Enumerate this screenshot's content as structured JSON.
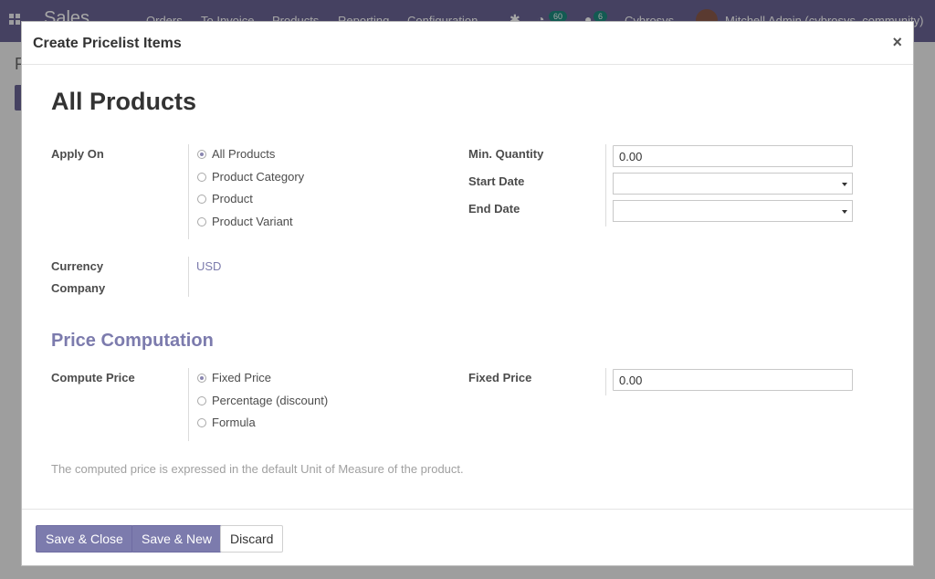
{
  "app": {
    "brand": "Sales",
    "menu": [
      "Orders",
      "To Invoice",
      "Products",
      "Reporting",
      "Configuration"
    ],
    "activity_count": "60",
    "messages_count": "6",
    "company": "Cybrosys",
    "user": "Mitchell Admin (cybrosys_community)",
    "page_title": "P"
  },
  "dialog": {
    "title": "Create Pricelist Items",
    "close_symbol": "×",
    "record_title": "All Products",
    "apply_on": {
      "label": "Apply On",
      "options": [
        "All Products",
        "Product Category",
        "Product",
        "Product Variant"
      ],
      "selected": "All Products"
    },
    "min_quantity": {
      "label": "Min. Quantity",
      "value": "0.00"
    },
    "start_date": {
      "label": "Start Date",
      "value": ""
    },
    "end_date": {
      "label": "End Date",
      "value": ""
    },
    "currency": {
      "label": "Currency",
      "value": "USD"
    },
    "company": {
      "label": "Company",
      "value": ""
    },
    "price_computation": {
      "section_title": "Price Computation",
      "label": "Compute Price",
      "options": [
        "Fixed Price",
        "Percentage (discount)",
        "Formula"
      ],
      "selected": "Fixed Price",
      "fixed_price": {
        "label": "Fixed Price",
        "value": "0.00"
      },
      "help": "The computed price is expressed in the default Unit of Measure of the product."
    },
    "buttons": {
      "save_close": "Save & Close",
      "save_new": "Save & New",
      "discard": "Discard"
    }
  },
  "colors": {
    "brand": "#6b6595",
    "primary": "#7c7bad",
    "badge": "#1e8a7e"
  }
}
